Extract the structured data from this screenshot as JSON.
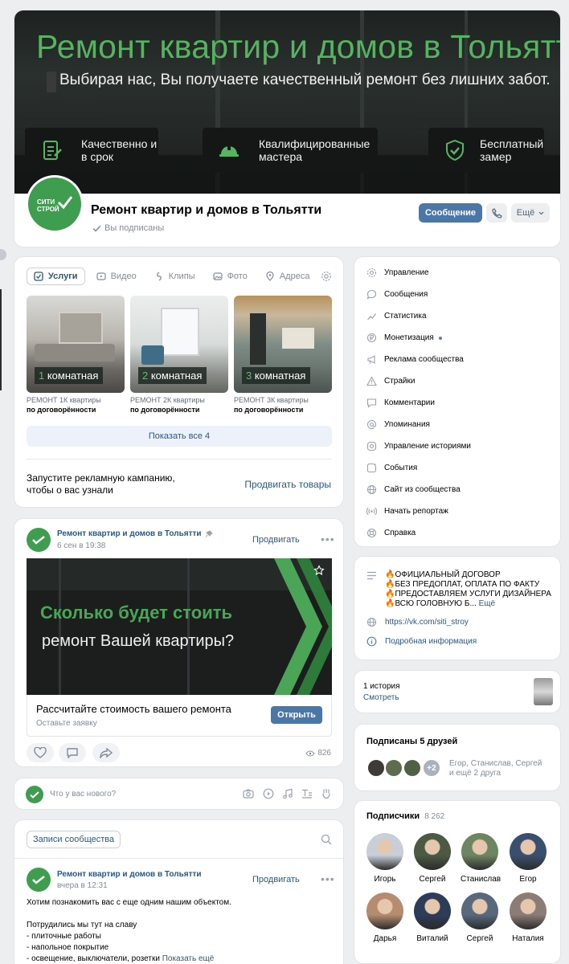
{
  "cover": {
    "banner_title": "Ремонт квартир и домов в Тольятти",
    "banner_subtitle": "Выбирая нас, Вы получаете качественный ремонт без лишних забот.",
    "features": [
      {
        "icon": "checklist-icon",
        "text": "Качественно и в срок"
      },
      {
        "icon": "worker-helmet-icon",
        "text": "Квалифицированные мастера"
      },
      {
        "icon": "shield-check-icon",
        "text": "Бесплатный замер"
      }
    ],
    "avatar_logo_top": "СИТИ",
    "avatar_logo_bottom": "СТРОЙ",
    "group_name": "Ремонт квартир и домов в Тольятти",
    "subscribed_status": "Вы подписаны",
    "message_button": "Сообщение",
    "more_button": "Ещё"
  },
  "services": {
    "tabs": [
      {
        "icon": "check-square-icon",
        "label": "Услуги",
        "active": true
      },
      {
        "icon": "video-icon",
        "label": "Видео",
        "active": false
      },
      {
        "icon": "clips-icon",
        "label": "Клипы",
        "active": false
      },
      {
        "icon": "photo-icon",
        "label": "Фото",
        "active": false
      },
      {
        "icon": "location-pin-icon",
        "label": "Адреса",
        "active": false
      }
    ],
    "items": [
      {
        "num": "1",
        "label": " комнатная",
        "name": "РЕМОНТ 1К квартиры",
        "price": "по договорённости"
      },
      {
        "num": "2",
        "label": " комнатная",
        "name": "РЕМОНТ 2К квартиры",
        "price": "по договорённости"
      },
      {
        "num": "3",
        "label": " комнатная",
        "name": "РЕМОНТ 3К квартиры",
        "price": "по договорённости"
      }
    ],
    "show_all": "Показать все 4",
    "promo_text_1": "Запустите рекламную кампанию,",
    "promo_text_2": "чтобы о вас узнали",
    "promo_link": "Продвигать товары"
  },
  "post": {
    "author": "Ремонт квартир и домов в Тольятти",
    "date": "6 сен в 19:38",
    "promote": "Продвигать",
    "image_line_1": "Сколько будет стоить",
    "image_line_2": "ремонт Вашей квартиры?",
    "cta_title": "Рассчитайте стоимость вашего ремонта",
    "cta_subtitle": "Оставьте заявку",
    "cta_button": "Открыть",
    "views": "826"
  },
  "composer": {
    "placeholder": "Что у вас нового?"
  },
  "wall": {
    "tab": "Записи сообщества",
    "author": "Ремонт квартир и домов в Тольятти",
    "date": "вчера в 12:31",
    "promote": "Продвигать",
    "text": "Хотим познакомить вас с еще одним нашим объектом.\n\nПотрудились мы тут на славу\n- плиточные работы\n- напольное покрытие\n- освещение, выключатели, розетки",
    "show_more": "Показать ещё"
  },
  "menu": [
    {
      "icon": "gear-icon",
      "label": "Управление"
    },
    {
      "icon": "message-icon",
      "label": "Сообщения"
    },
    {
      "icon": "stats-icon",
      "label": "Статистика"
    },
    {
      "icon": "coin-icon",
      "label": "Монетизация",
      "dot": true
    },
    {
      "icon": "megaphone-icon",
      "label": "Реклама сообщества"
    },
    {
      "icon": "warning-icon",
      "label": "Страйки"
    },
    {
      "icon": "comment-icon",
      "label": "Комментарии"
    },
    {
      "icon": "at-icon",
      "label": "Упоминания"
    },
    {
      "icon": "stories-icon",
      "label": "Управление историями"
    },
    {
      "icon": "calendar-icon",
      "label": "События"
    },
    {
      "icon": "globe-icon",
      "label": "Сайт из сообщества"
    },
    {
      "icon": "broadcast-icon",
      "label": "Начать репортаж"
    },
    {
      "icon": "help-icon",
      "label": "Справка"
    }
  ],
  "info": {
    "description": "🔥ОФИЦИАЛЬНЫЙ ДОГОВОР\n🔥БЕЗ ПРЕДОПЛАТ, ОПЛАТА ПО ФАКТУ\n🔥ПРЕДОСТАВЛЯЕМ УСЛУГИ ДИЗАЙНЕРА\n🔥ВСЮ ГОЛОВНУЮ Б...",
    "more": "Ещё",
    "site": "https://vk.com/siti_stroy",
    "details": "Подробная информация"
  },
  "story": {
    "count": "1 история",
    "view": "Смотреть"
  },
  "friends": {
    "title": "Подписаны 5 друзей",
    "extra": "+2",
    "names_1": "Егор, Станислав, Сергей",
    "names_2": "и ещё 2 друга"
  },
  "subscribers": {
    "title": "Подписчики",
    "count": "8 262",
    "people": [
      {
        "name": "Игорь",
        "color": "#c9cfd8"
      },
      {
        "name": "Сергей",
        "color": "#4c5a44"
      },
      {
        "name": "Станислав",
        "color": "#6d8560"
      },
      {
        "name": "Егор",
        "color": "#3a4f6e"
      },
      {
        "name": "Дарья",
        "color": "#b58c6f"
      },
      {
        "name": "Виталий",
        "color": "#2e3d57"
      },
      {
        "name": "Сергей",
        "color": "#58697e"
      },
      {
        "name": "Наталия",
        "color": "#8b7d76"
      }
    ]
  },
  "colors": {
    "brand": "#3e9d4f",
    "accent": "#4a76a8",
    "link": "#2a5885"
  }
}
